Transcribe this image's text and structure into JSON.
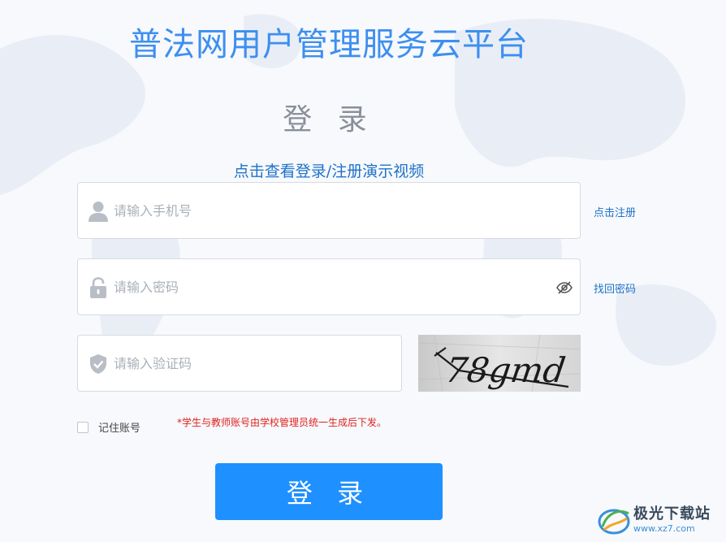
{
  "app_title": "普法网用户管理服务云平台",
  "login_heading": "登 录",
  "demo_video_link": "点击查看登录/注册演示视频",
  "phone_field": {
    "placeholder": "请输入手机号",
    "value": ""
  },
  "password_field": {
    "placeholder": "请输入密码",
    "value": ""
  },
  "code_field": {
    "placeholder": "请输入验证码",
    "value": ""
  },
  "register_link": "点击注册",
  "forgot_password_link": "找回密码",
  "captcha_text": "78gmd",
  "remember_label": "记住账号",
  "remember_checked": false,
  "notice_text": "*学生与教师账号由学校管理员统一生成后下发。",
  "submit_label": "登 录",
  "watermark": {
    "site_name": "极光下载站",
    "url": "www.xz7.com"
  },
  "colors": {
    "title": "#3d8ff0",
    "link": "#1f72c9",
    "notice": "#e0221e",
    "button": "#1e90ff",
    "heading_gray": "#8a8f98"
  },
  "icons": {
    "phone_field": "user-icon",
    "password_field": "lock-icon",
    "code_field": "shield-check-icon",
    "password_visibility": "eye-slash-icon",
    "watermark": "aurora-logo-icon"
  }
}
